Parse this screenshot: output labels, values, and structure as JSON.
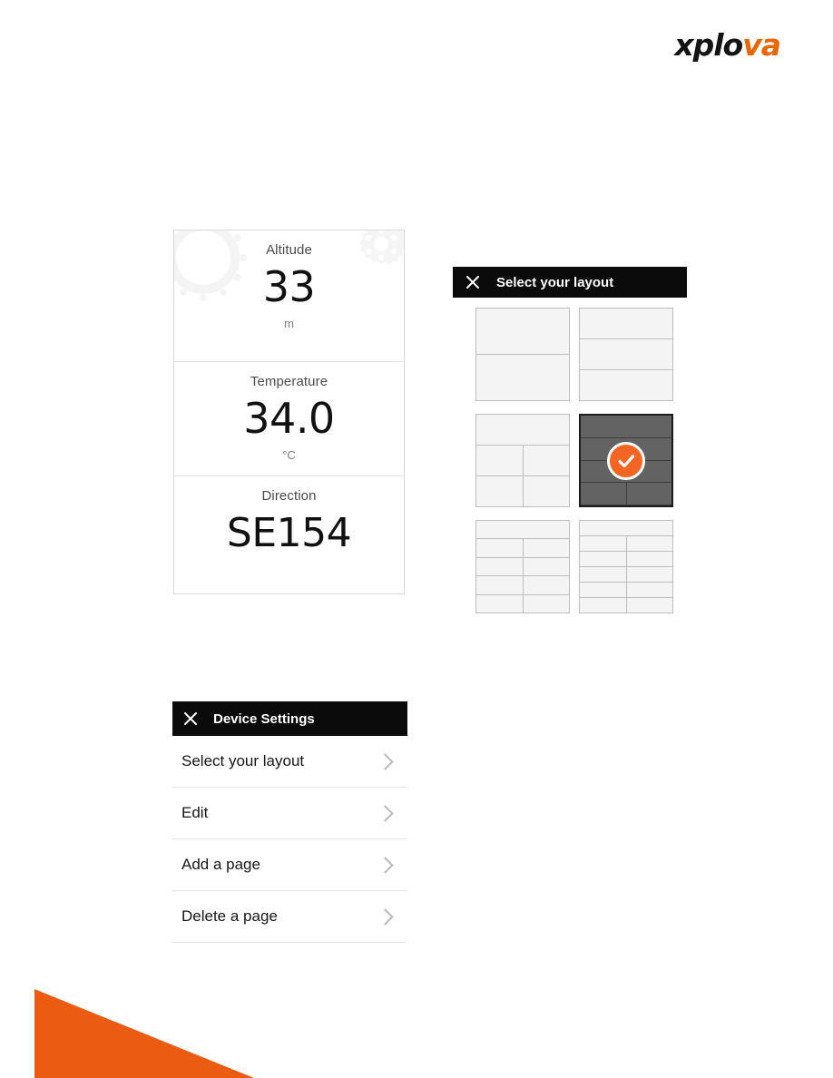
{
  "brand": {
    "logo_dark": "xplo",
    "logo_accent": "va",
    "accent_color": "#ec6608"
  },
  "device_screen": {
    "metrics": [
      {
        "label": "Altitude",
        "value": "33",
        "unit": "m"
      },
      {
        "label": "Temperature",
        "value": "34.0",
        "unit": "°C"
      },
      {
        "label": "Direction",
        "value": "SE154",
        "unit": ""
      }
    ],
    "watermarks": [
      "chainring-icon",
      "gear-icon"
    ]
  },
  "layout_panel": {
    "header": {
      "title": "Select your layout",
      "close_icon": "close-icon"
    },
    "selected_index": 3,
    "selected_color": "#636363",
    "check_color": "#f26522",
    "tiles": [
      {
        "name": "layout-2-rows",
        "rows": [
          1,
          1
        ]
      },
      {
        "name": "layout-3-rows",
        "rows": [
          1,
          1,
          1
        ]
      },
      {
        "name": "layout-1-top-2x2",
        "rows": [
          1,
          2,
          2
        ]
      },
      {
        "name": "layout-3-rows-split-bottom",
        "rows": [
          1,
          1,
          1,
          2
        ],
        "selected": true
      },
      {
        "name": "layout-1-top-4x2",
        "rows": [
          1,
          2,
          2,
          2,
          2
        ]
      },
      {
        "name": "layout-1-top-5x2",
        "rows": [
          1,
          2,
          2,
          2,
          2,
          2
        ]
      }
    ]
  },
  "settings_panel": {
    "header": {
      "title": "Device Settings",
      "close_icon": "close-icon"
    },
    "items": [
      {
        "label": "Select your layout",
        "chevron": "chevron-right-icon"
      },
      {
        "label": "Edit",
        "chevron": "chevron-right-icon"
      },
      {
        "label": "Add a page",
        "chevron": "chevron-right-icon"
      },
      {
        "label": "Delete a page",
        "chevron": "chevron-right-icon"
      }
    ]
  },
  "decoration": {
    "wedge_color": "#ec5b12"
  }
}
